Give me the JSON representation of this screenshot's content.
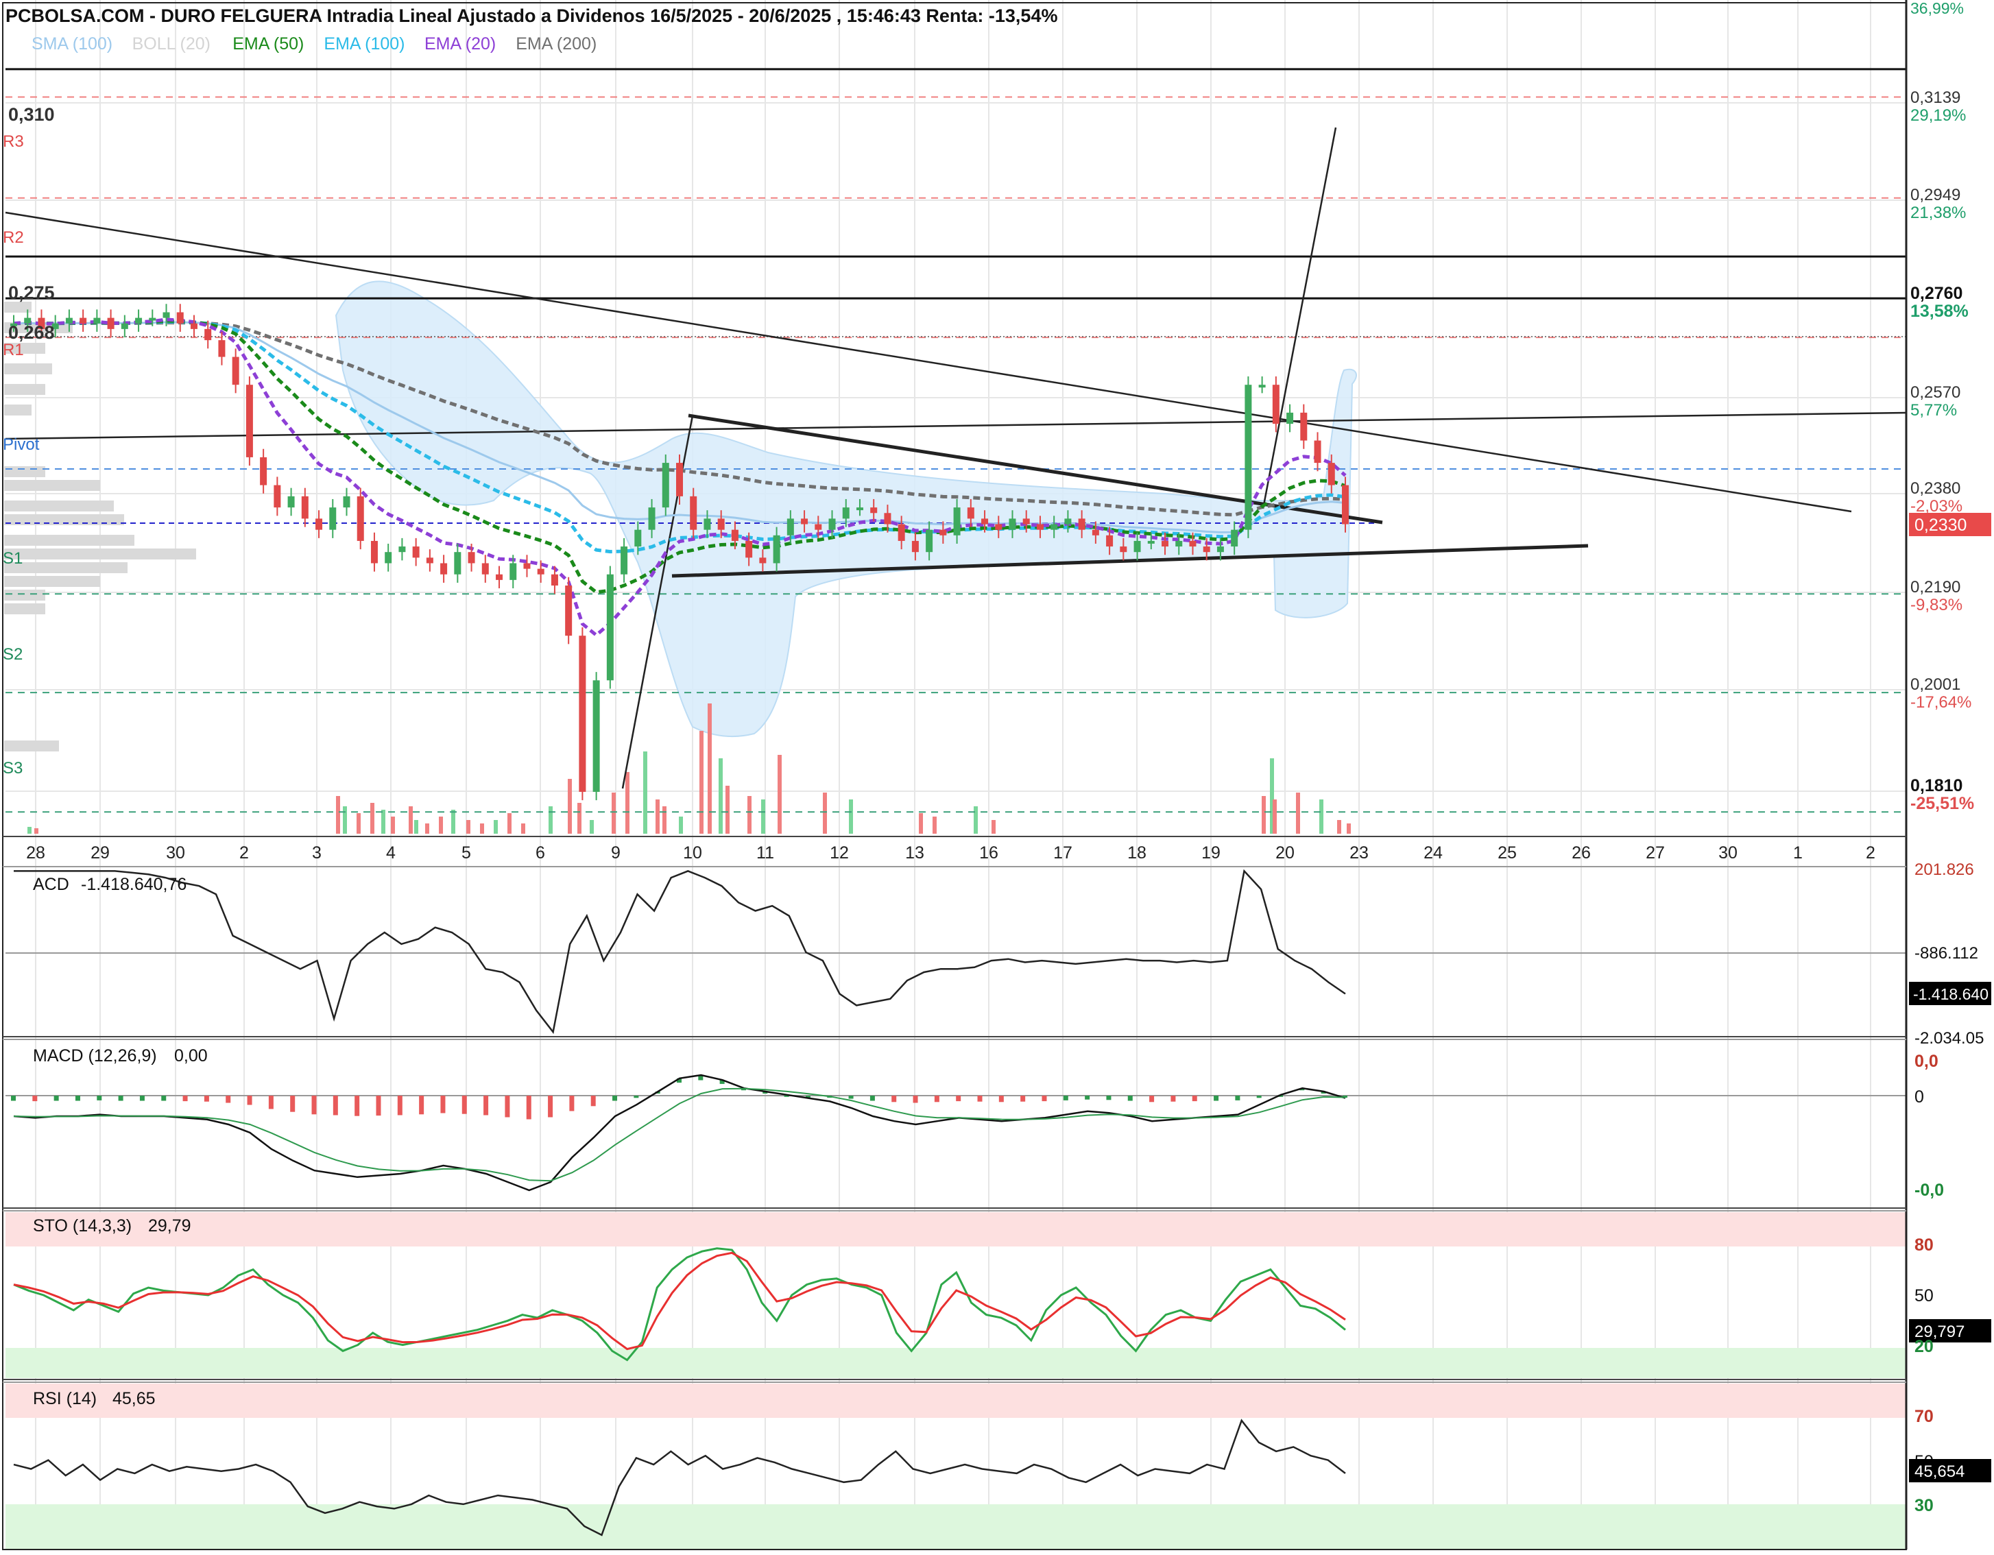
{
  "header": {
    "title": "PCBOLSA.COM - DURO FELGUERA Intradia Lineal Ajustado a Dividenos 16/5/2025 - 20/6/2025 , 15:46:43 Renta: -13,54%"
  },
  "legend": [
    {
      "label": "SMA (100)",
      "color": "#9dc9ec"
    },
    {
      "label": "BOLL (20)",
      "color": "#d4d4d4"
    },
    {
      "label": "EMA (50)",
      "color": "#1a8a1a"
    },
    {
      "label": "EMA (100)",
      "color": "#2bbbe8"
    },
    {
      "label": "EMA (20)",
      "color": "#8d3fd6"
    },
    {
      "label": "EMA (200)",
      "color": "#707070"
    }
  ],
  "price_axis": {
    "top_cut_pct": "36,99%",
    "levels": [
      {
        "price": "0,3139",
        "pct": "29,19%",
        "pct_color": "#1e9e6a"
      },
      {
        "price": "0,2949",
        "pct": "21,38%",
        "pct_color": "#1e9e6a"
      },
      {
        "price": "0,2760",
        "pct": "13,58%",
        "pct_color": "#1e9e6a"
      },
      {
        "price": "0,2570",
        "pct": "5,77%",
        "pct_color": "#1e9e6a"
      },
      {
        "price": "0,2380",
        "pct": "-2,03%",
        "pct_color": "#e05050"
      },
      {
        "price": "0,2190",
        "pct": "-9,83%",
        "pct_color": "#e05050"
      },
      {
        "price": "0,2001",
        "pct": "-17,64%",
        "pct_color": "#e05050"
      },
      {
        "price": "0,1810",
        "pct": "-25,51%",
        "pct_color": "#e05050"
      }
    ],
    "current_price": "0,2330"
  },
  "horizontal_labels": {
    "l310": "0,310",
    "l275": "0,275",
    "l268": "0,268",
    "r3": "R3",
    "r2": "R2",
    "r1": "R1",
    "pivot": "Pivot",
    "s1": "S1",
    "s2": "S2",
    "s3": "S3"
  },
  "x_axis": {
    "labels": [
      "28",
      "29",
      "30",
      "2",
      "3",
      "4",
      "5",
      "6",
      "9",
      "10",
      "11",
      "12",
      "13",
      "16",
      "17",
      "18",
      "19",
      "20",
      "23",
      "24",
      "25",
      "26",
      "27",
      "30",
      "1",
      "2"
    ]
  },
  "panels": {
    "acd": {
      "title": "ACD",
      "value": "-1.418.640,76",
      "axis_top": "201.826",
      "axis_mid": "-886.112",
      "axis_current": "-1.418.640",
      "axis_bottom": "-2.034.05"
    },
    "macd": {
      "title": "MACD (12,26,9)",
      "value": "0,00",
      "axis_top": "0,0",
      "axis_mid": "0",
      "axis_bottom": "-0,0"
    },
    "sto": {
      "title": "STO (14,3,3)",
      "value": "29,79",
      "axis_80": "80",
      "axis_50": "50",
      "axis_current": "29,797",
      "axis_20": "20"
    },
    "rsi": {
      "title": "RSI (14)",
      "value": "45,65",
      "axis_70": "70",
      "axis_50": "50",
      "axis_current": "45,654",
      "axis_30": "30"
    }
  },
  "chart_data": {
    "type": "candlestick",
    "symbol": "DURO FELGUERA",
    "y_range": [
      0.177,
      0.327
    ],
    "reference_lines": {
      "R3": 0.3096,
      "R2": 0.2915,
      "R1": 0.2665,
      "Pivot": 0.2429,
      "S1": 0.2205,
      "S2": 0.2028,
      "S3": 0.1814,
      "0,310": 0.3146,
      "0,275": 0.281,
      "0,268": 0.2735
    },
    "sessions": [
      "28",
      "29",
      "30",
      "2",
      "3",
      "4",
      "5",
      "6",
      "9",
      "10",
      "11",
      "12",
      "13",
      "16",
      "17",
      "18",
      "19",
      "20",
      "23"
    ],
    "close_series": [
      0.269,
      0.27,
      0.268,
      0.269,
      0.27,
      0.269,
      0.27,
      0.268,
      0.269,
      0.27,
      0.27,
      0.271,
      0.269,
      0.268,
      0.266,
      0.263,
      0.258,
      0.245,
      0.24,
      0.236,
      0.238,
      0.234,
      0.232,
      0.236,
      0.238,
      0.23,
      0.226,
      0.228,
      0.229,
      0.227,
      0.226,
      0.224,
      0.228,
      0.226,
      0.224,
      0.223,
      0.226,
      0.225,
      0.224,
      0.222,
      0.213,
      0.185,
      0.205,
      0.224,
      0.229,
      0.232,
      0.236,
      0.244,
      0.238,
      0.232,
      0.234,
      0.232,
      0.23,
      0.227,
      0.226,
      0.231,
      0.234,
      0.233,
      0.232,
      0.234,
      0.236,
      0.236,
      0.235,
      0.233,
      0.23,
      0.228,
      0.232,
      0.231,
      0.236,
      0.234,
      0.233,
      0.232,
      0.234,
      0.233,
      0.232,
      0.233,
      0.234,
      0.232,
      0.231,
      0.229,
      0.228,
      0.23,
      0.23,
      0.229,
      0.23,
      0.229,
      0.228,
      0.229,
      0.232,
      0.258,
      0.258,
      0.251,
      0.253,
      0.248,
      0.244,
      0.24,
      0.233
    ],
    "acd_series": [
      0.99,
      0.99,
      0.99,
      0.99,
      0.99,
      0.99,
      0.99,
      0.98,
      0.97,
      0.95,
      0.92,
      0.9,
      0.85,
      0.6,
      0.55,
      0.5,
      0.45,
      0.4,
      0.45,
      0.1,
      0.45,
      0.55,
      0.62,
      0.55,
      0.58,
      0.65,
      0.62,
      0.55,
      0.4,
      0.38,
      0.32,
      0.15,
      0.02,
      0.55,
      0.72,
      0.45,
      0.62,
      0.85,
      0.75,
      0.95,
      0.99,
      0.95,
      0.9,
      0.8,
      0.75,
      0.78,
      0.72,
      0.5,
      0.45,
      0.25,
      0.18,
      0.2,
      0.22,
      0.33,
      0.38,
      0.4,
      0.4,
      0.41,
      0.45,
      0.46,
      0.44,
      0.45,
      0.44,
      0.43,
      0.44,
      0.45,
      0.46,
      0.45,
      0.45,
      0.44,
      0.45,
      0.44,
      0.45,
      0.99,
      0.88,
      0.52,
      0.45,
      0.4,
      0.32,
      0.25
    ],
    "macd_series": [
      0.55,
      0.54,
      0.55,
      0.55,
      0.56,
      0.55,
      0.55,
      0.55,
      0.54,
      0.53,
      0.5,
      0.45,
      0.35,
      0.28,
      0.22,
      0.2,
      0.18,
      0.19,
      0.2,
      0.22,
      0.25,
      0.23,
      0.2,
      0.15,
      0.1,
      0.15,
      0.3,
      0.42,
      0.55,
      0.62,
      0.7,
      0.78,
      0.8,
      0.77,
      0.72,
      0.7,
      0.68,
      0.66,
      0.64,
      0.6,
      0.55,
      0.52,
      0.5,
      0.52,
      0.54,
      0.53,
      0.52,
      0.53,
      0.54,
      0.56,
      0.58,
      0.57,
      0.55,
      0.52,
      0.53,
      0.54,
      0.55,
      0.56,
      0.62,
      0.68,
      0.72,
      0.7,
      0.66
    ],
    "sto_series": [
      62,
      58,
      55,
      50,
      45,
      52,
      48,
      44,
      56,
      60,
      58,
      57,
      56,
      55,
      60,
      68,
      72,
      62,
      55,
      50,
      40,
      25,
      18,
      22,
      30,
      24,
      22,
      24,
      26,
      28,
      30,
      32,
      35,
      38,
      42,
      40,
      45,
      42,
      38,
      30,
      18,
      12,
      24,
      60,
      72,
      80,
      84,
      86,
      85,
      72,
      50,
      38,
      55,
      62,
      65,
      66,
      62,
      60,
      55,
      30,
      18,
      30,
      62,
      70,
      50,
      42,
      40,
      35,
      25,
      45,
      55,
      60,
      50,
      42,
      28,
      18,
      32,
      42,
      45,
      40,
      38,
      52,
      64,
      68,
      72,
      60,
      48,
      46,
      40,
      32
    ],
    "rsi_series": [
      52,
      50,
      54,
      47,
      52,
      45,
      50,
      48,
      52,
      49,
      51,
      50,
      49,
      50,
      52,
      49,
      44,
      33,
      30,
      32,
      35,
      33,
      32,
      34,
      38,
      35,
      34,
      36,
      38,
      37,
      36,
      34,
      32,
      24,
      20,
      42,
      55,
      52,
      58,
      52,
      56,
      50,
      52,
      55,
      53,
      50,
      48,
      46,
      44,
      45,
      52,
      58,
      50,
      48,
      50,
      52,
      50,
      49,
      48,
      52,
      50,
      46,
      44,
      48,
      52,
      47,
      50,
      49,
      48,
      52,
      50,
      72,
      62,
      58,
      60,
      56,
      54,
      48
    ]
  }
}
